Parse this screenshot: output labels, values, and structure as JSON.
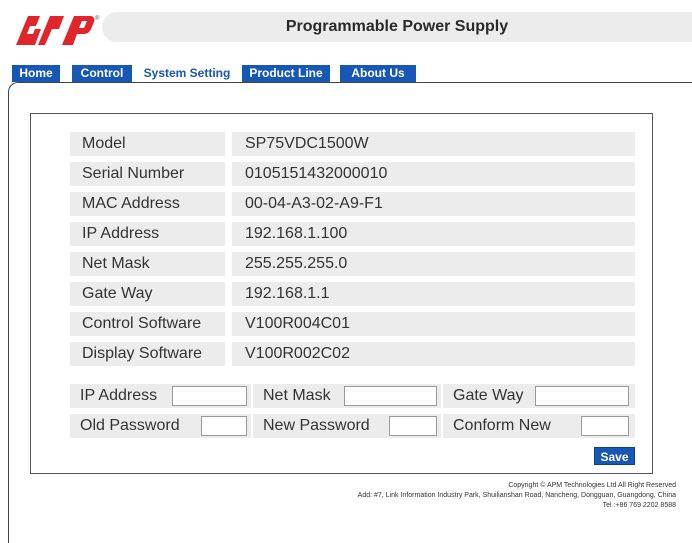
{
  "header": {
    "title": "Programmable Power Supply",
    "brand": "APM"
  },
  "tabs": [
    {
      "label": "Home"
    },
    {
      "label": "Control"
    },
    {
      "label": "System Setting",
      "active": true
    },
    {
      "label": "Product Line"
    },
    {
      "label": "About Us"
    }
  ],
  "info": [
    {
      "label": "Model",
      "value": "SP75VDC1500W"
    },
    {
      "label": "Serial Number",
      "value": "0105151432000010"
    },
    {
      "label": "MAC Address",
      "value": "00-04-A3-02-A9-F1"
    },
    {
      "label": "IP Address",
      "value": "192.168.1.100"
    },
    {
      "label": "Net Mask",
      "value": "255.255.255.0"
    },
    {
      "label": "Gate Way",
      "value": "192.168.1.1"
    },
    {
      "label": "Control Software",
      "value": "V100R004C01"
    },
    {
      "label": "Display Software",
      "value": "V100R002C02"
    }
  ],
  "form": {
    "row1": [
      {
        "label": "IP Address",
        "value": ""
      },
      {
        "label": "Net Mask",
        "value": ""
      },
      {
        "label": "Gate Way",
        "value": ""
      }
    ],
    "row2": [
      {
        "label": "Old Password",
        "value": ""
      },
      {
        "label": "New Password",
        "value": ""
      },
      {
        "label": "Conform New",
        "value": ""
      }
    ]
  },
  "save_label": "Save",
  "footer": {
    "copyright": "Copyright © APM Technologies Ltd All Right Reserved",
    "address": "Add: #7, Link Information Industry Park, Shuilianshan Road, Nancheng, Dongguan, Guangdong, China",
    "tel": "Tel :+86 769 2202 8588"
  },
  "colors": {
    "brand_red": "#e0262b",
    "tab_blue": "#1757b5",
    "row_gray": "#ececec"
  }
}
